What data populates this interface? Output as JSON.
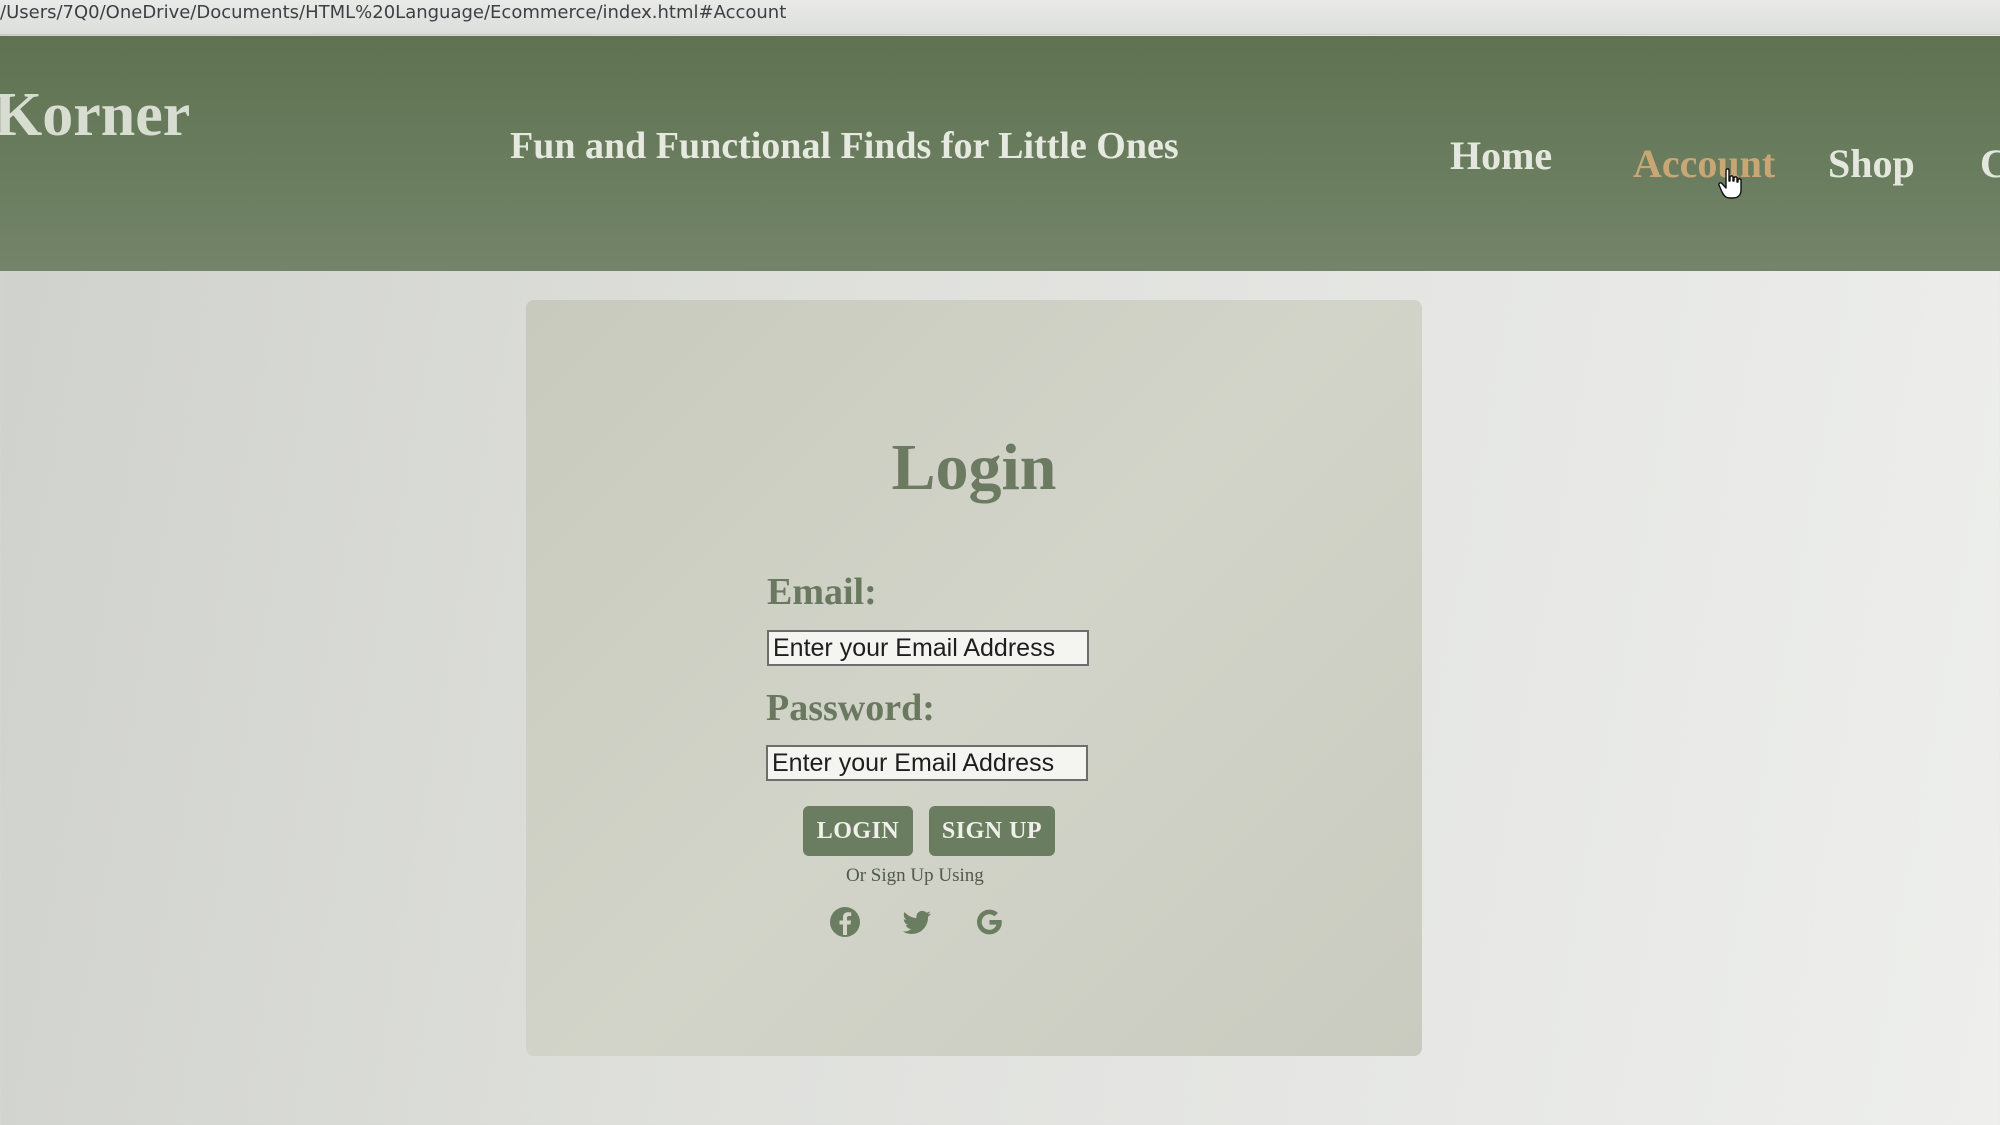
{
  "browser": {
    "url": "/Users/7Q0/OneDrive/Documents/HTML%20Language/Ecommerce/index.html#Account"
  },
  "header": {
    "brand": "Korner",
    "tagline": "Fun and Functional Finds for Little Ones",
    "nav": [
      {
        "label": "Home"
      },
      {
        "label": "Account",
        "active": true
      },
      {
        "label": "Shop"
      },
      {
        "label": "C"
      }
    ]
  },
  "login": {
    "title": "Login",
    "email_label": "Email:",
    "email_placeholder": "Enter your Email Address",
    "password_label": "Password:",
    "password_placeholder": "Enter your Email Address",
    "login_button": "LOGIN",
    "signup_button": "SIGN UP",
    "alt_signup_text": "Or Sign Up Using",
    "social_icons": [
      "facebook-icon",
      "twitter-icon",
      "google-icon"
    ]
  },
  "colors": {
    "header_bg": "#667a58",
    "accent_active_nav": "#c8a774",
    "button_bg": "#6b7d60",
    "card_bg": "#cfd1c5"
  }
}
